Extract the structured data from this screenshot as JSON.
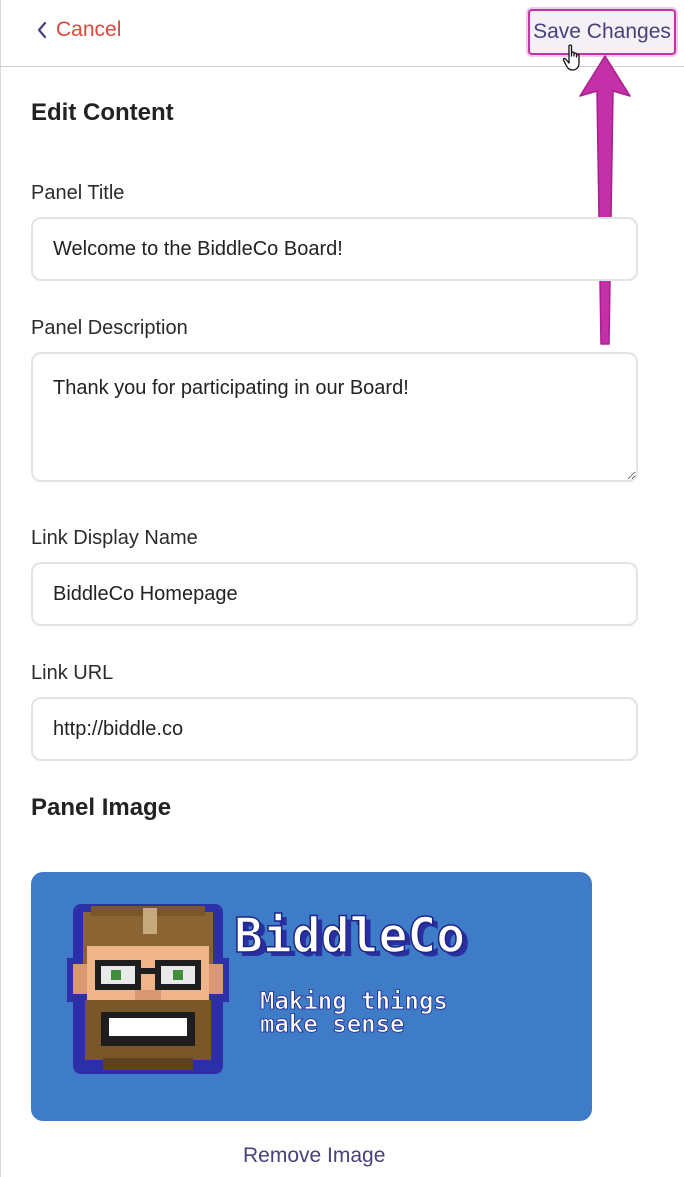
{
  "header": {
    "cancel_label": "Cancel",
    "save_label": "Save Changes"
  },
  "form": {
    "section_title": "Edit Content",
    "panel_title_label": "Panel Title",
    "panel_title_value": "Welcome to the BiddleCo Board!",
    "panel_description_label": "Panel Description",
    "panel_description_value": "Thank you for participating in our Board!",
    "link_display_name_label": "Link Display Name",
    "link_display_name_value": "BiddleCo Homepage",
    "link_url_label": "Link URL",
    "link_url_value": "http://biddle.co"
  },
  "image_section": {
    "title": "Panel Image",
    "logo_name": "BiddleCo",
    "tagline_line1": "Making things",
    "tagline_line2": "make sense",
    "remove_label": "Remove Image"
  },
  "colors": {
    "cancel": "#e0463a",
    "annotation_arrow": "#c430a8",
    "button_text": "#4a3f7a",
    "image_background": "#3f7cc8"
  },
  "icons": [
    "chevron-left-icon",
    "hand-pointer-icon",
    "resize-grip-icon"
  ]
}
